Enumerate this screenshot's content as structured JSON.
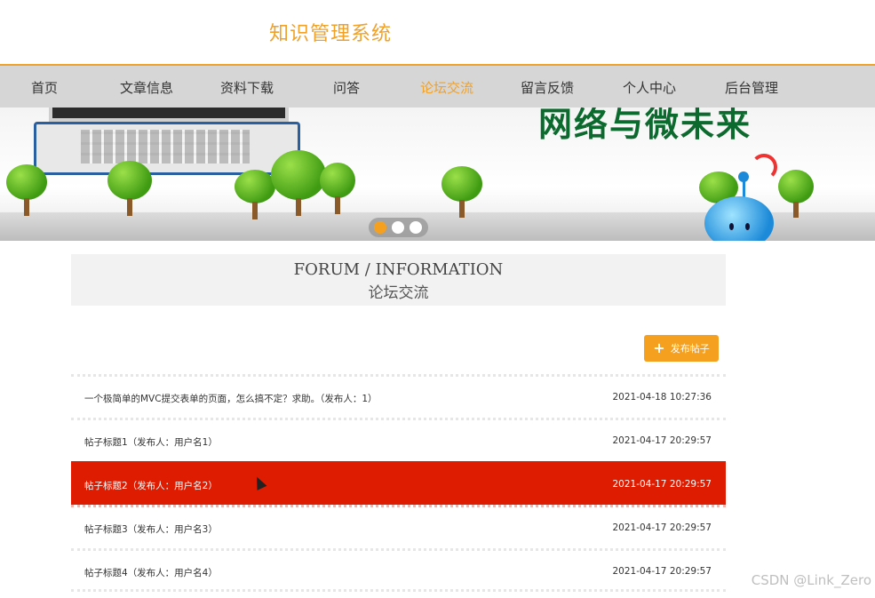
{
  "site": {
    "title": "知识管理系统"
  },
  "nav": {
    "items": [
      {
        "label": "首页"
      },
      {
        "label": "文章信息"
      },
      {
        "label": "资料下载"
      },
      {
        "label": "问答"
      },
      {
        "label": "论坛交流"
      },
      {
        "label": "留言反馈"
      },
      {
        "label": "个人中心"
      },
      {
        "label": "后台管理"
      }
    ],
    "active_index": 4,
    "accent_color": "#f0a12a"
  },
  "banner": {
    "text": "网络与微未来",
    "slide_count": 3,
    "active_slide": 0
  },
  "section": {
    "title_en": "FORUM / INFORMATION",
    "title_cn": "论坛交流"
  },
  "post_button": {
    "label": "发布帖子",
    "icon": "plus-icon",
    "color": "#f5a11f"
  },
  "posts": [
    {
      "title": "一个极简单的MVC提交表单的页面，怎么搞不定？求助。（发布人：1）",
      "time": "2021-04-18 10:27:36"
    },
    {
      "title": "帖子标题1（发布人：用户名1）",
      "time": "2021-04-17 20:29:57"
    },
    {
      "title": "帖子标题2（发布人：用户名2）",
      "time": "2021-04-17 20:29:57"
    },
    {
      "title": "帖子标题3（发布人：用户名3）",
      "time": "2021-04-17 20:29:57"
    },
    {
      "title": "帖子标题4（发布人：用户名4）",
      "time": "2021-04-17 20:29:57"
    }
  ],
  "hover_row_index": 2,
  "hover_color": "#dd1c02",
  "watermark": "CSDN @Link_Zero"
}
